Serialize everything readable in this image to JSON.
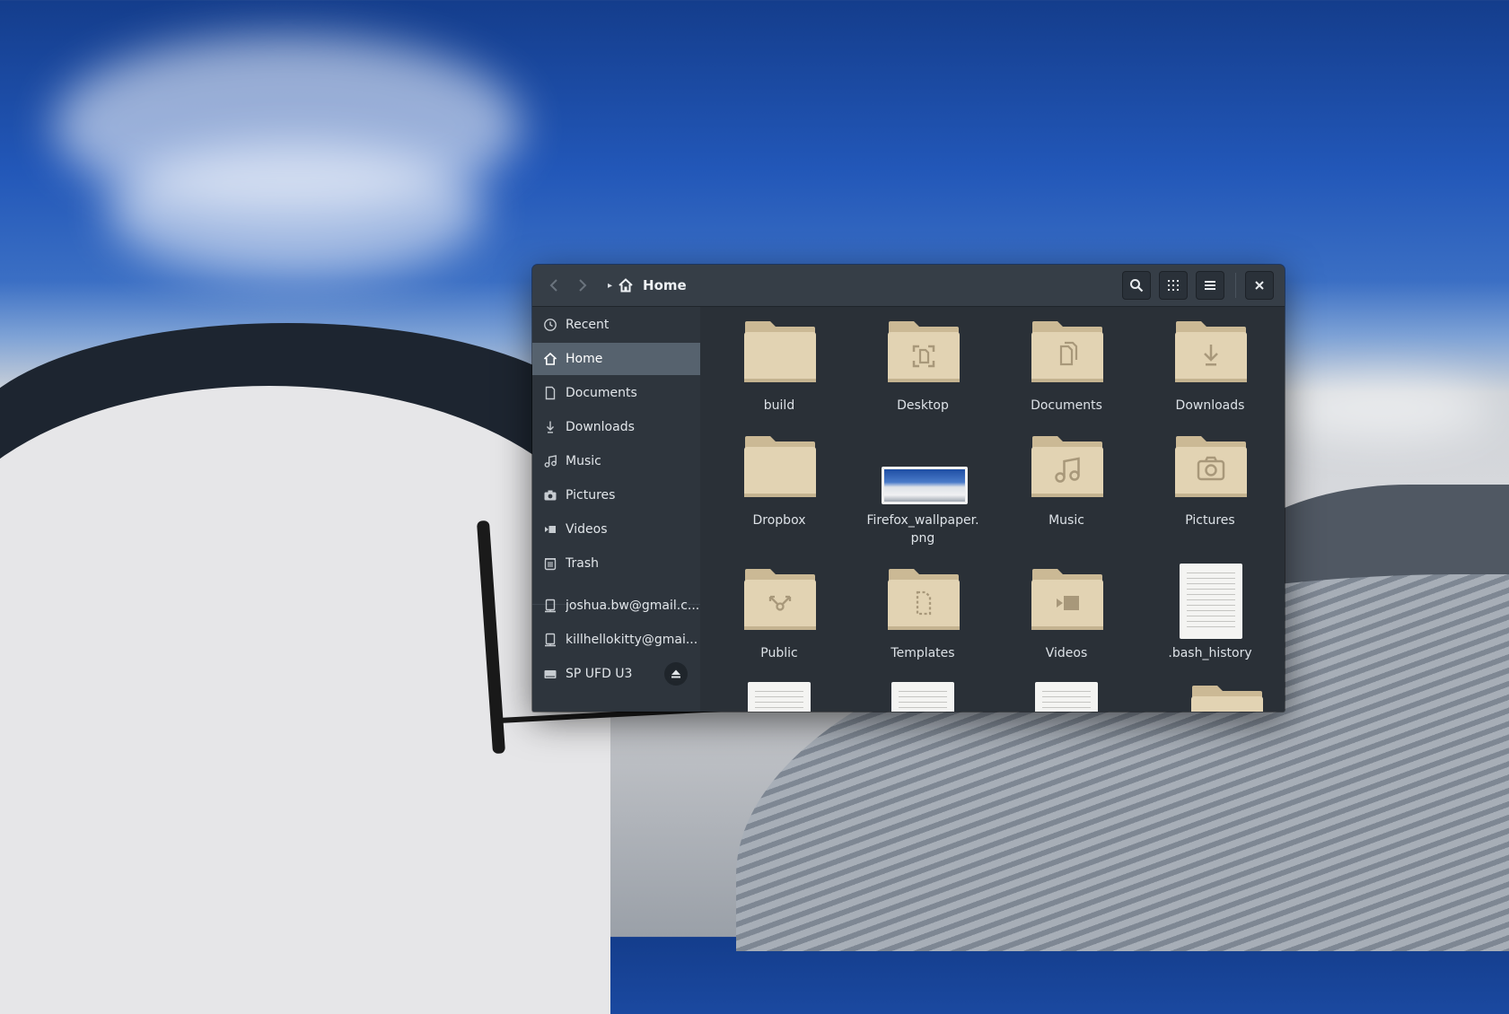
{
  "window": {
    "breadcrumb": {
      "current": "Home"
    }
  },
  "sidebar": {
    "items": [
      {
        "label": "Recent",
        "icon": "clock-icon"
      },
      {
        "label": "Home",
        "icon": "home-icon",
        "active": true
      },
      {
        "label": "Documents",
        "icon": "document-icon"
      },
      {
        "label": "Downloads",
        "icon": "download-icon"
      },
      {
        "label": "Music",
        "icon": "music-icon"
      },
      {
        "label": "Pictures",
        "icon": "camera-icon"
      },
      {
        "label": "Videos",
        "icon": "video-icon"
      },
      {
        "label": "Trash",
        "icon": "trash-icon"
      }
    ],
    "accounts": [
      {
        "label": "joshua.bw@gmail.c...",
        "icon": "network-account-icon"
      },
      {
        "label": "killhellokitty@gmai...",
        "icon": "network-account-icon"
      }
    ],
    "drive": {
      "label": "SP UFD U3",
      "icon": "drive-icon"
    }
  },
  "files": [
    {
      "name": "build",
      "type": "folder"
    },
    {
      "name": "Desktop",
      "type": "folder-desktop"
    },
    {
      "name": "Documents",
      "type": "folder-documents"
    },
    {
      "name": "Downloads",
      "type": "folder-downloads"
    },
    {
      "name": "Dropbox",
      "type": "folder"
    },
    {
      "name": "Firefox_wallpaper.",
      "name2": "png",
      "type": "image"
    },
    {
      "name": "Music",
      "type": "folder-music"
    },
    {
      "name": "Pictures",
      "type": "folder-pictures"
    },
    {
      "name": "Public",
      "type": "folder-public"
    },
    {
      "name": "Templates",
      "type": "folder-templates"
    },
    {
      "name": "Videos",
      "type": "folder-videos"
    },
    {
      "name": ".bash_history",
      "type": "text"
    }
  ],
  "colors": {
    "accent": "#56626e",
    "folder": "#e2d3b3",
    "folder_tab": "#cbb995",
    "window_bg": "#2c333b"
  }
}
